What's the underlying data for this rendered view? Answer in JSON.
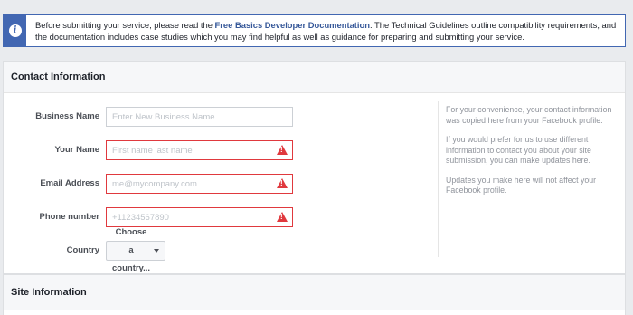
{
  "notice": {
    "text_before": "Before submitting your service, please read the ",
    "link": "Free Basics Developer Documentation",
    "text_after": ". The Technical Guidelines outline compatibility requirements, and the documentation includes case studies which you may find helpful as well as guidance for preparing and submitting your service."
  },
  "contact": {
    "title": "Contact Information",
    "fields": {
      "business_name": {
        "label": "Business Name",
        "placeholder": "Enter New Business Name",
        "value": ""
      },
      "your_name": {
        "label": "Your Name",
        "placeholder": "First name last name",
        "value": ""
      },
      "email": {
        "label": "Email Address",
        "placeholder": "me@mycompany.com",
        "value": ""
      },
      "phone": {
        "label": "Phone number",
        "placeholder": "+11234567890",
        "value": ""
      }
    },
    "country": {
      "label": "Country",
      "selected": "Choose a country..."
    },
    "side_notes": [
      "For your convenience, your contact information was copied here from your Facebook profile.",
      "If you would prefer for us to use different information to contact you about your site submission, you can make updates here.",
      "Updates you make here will not affect your Facebook profile."
    ]
  },
  "site": {
    "title": "Site Information"
  },
  "colors": {
    "accent": "#4267b2",
    "error": "#e0393e",
    "link": "#365899"
  },
  "icons": {
    "notice": "info-icon",
    "validation": "warning-icon",
    "dropdown": "caret-down-icon"
  }
}
